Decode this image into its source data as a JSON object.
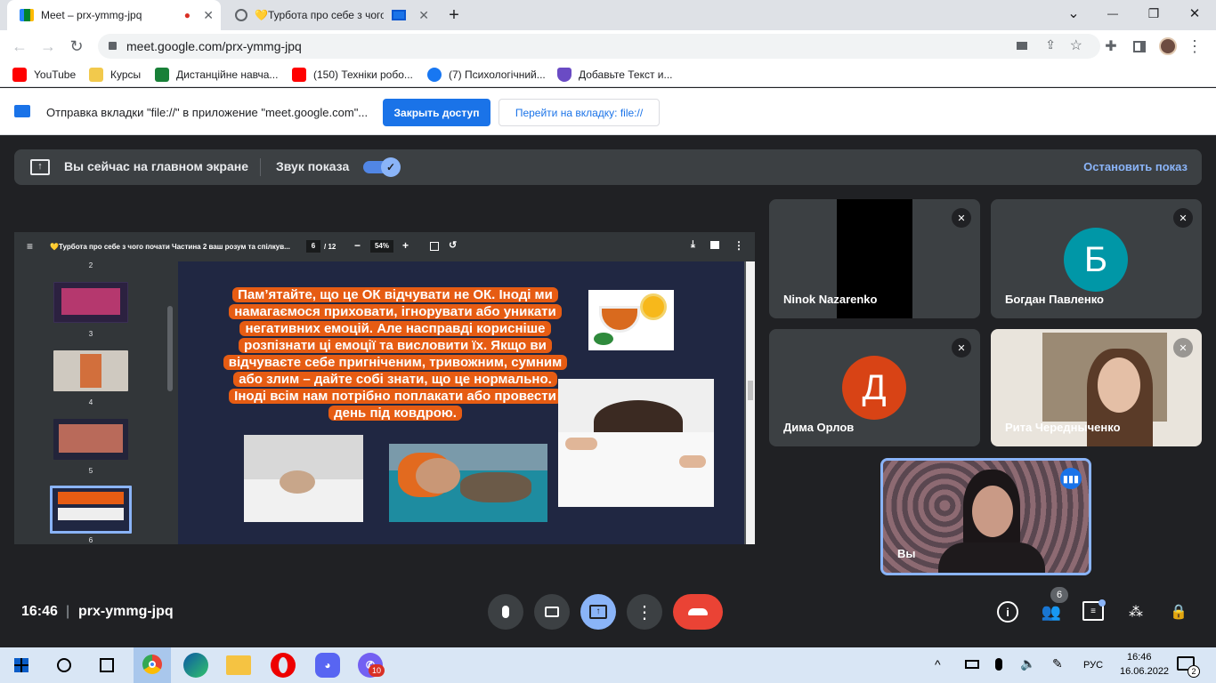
{
  "tabs": [
    {
      "title": "Meet – prx-ymmg-jpq",
      "recording": "●",
      "close": "✕"
    },
    {
      "title": "💛Турбота про себе з чого",
      "close": "✕"
    }
  ],
  "new_tab": "+",
  "window_controls": {
    "minimize": "—",
    "maximize": "❐",
    "close": "✕",
    "tabsearch": "⌄"
  },
  "address": "meet.google.com/prx-ymmg-jpq",
  "bookmarks": [
    {
      "label": "YouTube",
      "color": "#ff0000"
    },
    {
      "label": "Курсы",
      "color": "#f2c94c"
    },
    {
      "label": "Дистанційне навча...",
      "color": "#188038"
    },
    {
      "label": "(150) Техніки робо...",
      "color": "#ff0000"
    },
    {
      "label": "(7) Психологічний...",
      "color": "#1877f2"
    },
    {
      "label": "Добавьте Текст и...",
      "color": "#6a4bc4"
    }
  ],
  "infobar": {
    "message": "Отправка вкладки \"file://\" в приложение \"meet.google.com\"...",
    "primary": "Закрыть доступ",
    "secondary": "Перейти на вкладку: file://"
  },
  "presenting": {
    "status": "Вы сейчас на главном экране",
    "audio_label": "Звук показа",
    "audio_on": true,
    "stop": "Остановить показ"
  },
  "pdf": {
    "title": "💛Турбота про себе з чого почати Частина 2 ваш розум та спілкув...",
    "page": "6",
    "pages": "/ 12",
    "zoom": "54%",
    "thumb_numbers": [
      "2",
      "3",
      "4",
      "5",
      "6"
    ],
    "slide_text": "Пам’ятайте, що це ОК відчувати не ОК. Іноді ми намагаємося приховати, ігнорувати або уникати негативних емоцій. Але насправді корисніше розпізнати ці емоції та висловити їх. Якщо ви відчуваєте себе пригніченим, тривожним, сумним або злим – дайте собі знати, що це нормально. Іноді всім нам потрібно поплакати або провести день під ковдрою."
  },
  "participants": [
    {
      "name": "Ninok Nazarenko",
      "muted": true
    },
    {
      "name": "Богдан Павленко",
      "initial": "Б",
      "color": "#0097a7",
      "muted": true
    },
    {
      "name": "Дима Орлов",
      "initial": "Д",
      "color": "#d84315",
      "muted": true
    },
    {
      "name": "Рита Чередныченко",
      "muted": true
    },
    {
      "name": "Вы",
      "speaking": true
    }
  ],
  "footer": {
    "time": "16:46",
    "separator": "|",
    "meeting_code": "prx-ymmg-jpq",
    "participants_count": "6"
  },
  "taskbar": {
    "lang": "РУС",
    "time": "16:46",
    "date": "16.06.2022",
    "notifications": "2",
    "viber_badge": "10"
  }
}
